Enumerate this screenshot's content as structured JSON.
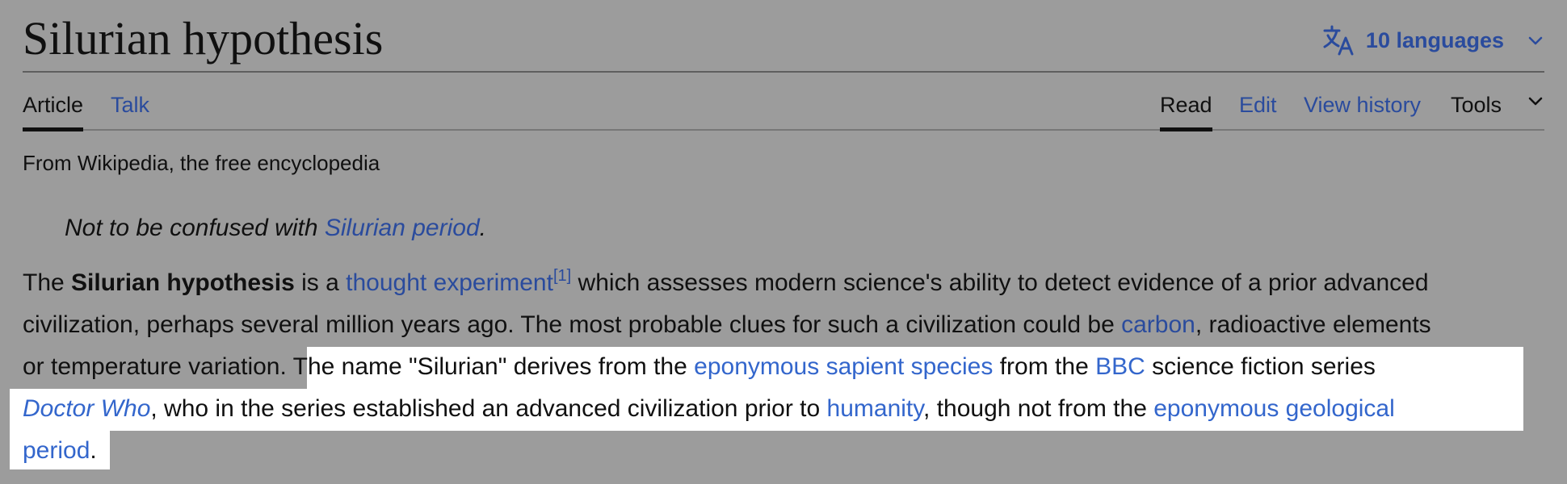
{
  "header": {
    "title": "Silurian hypothesis",
    "languages_label": "10 languages"
  },
  "tabs": {
    "left": [
      {
        "label": "Article",
        "selected": true
      },
      {
        "label": "Talk",
        "selected": false
      }
    ],
    "right": [
      {
        "label": "Read",
        "selected": true
      },
      {
        "label": "Edit",
        "selected": false
      },
      {
        "label": "View history",
        "selected": false
      },
      {
        "label": "Tools",
        "selected": false
      }
    ]
  },
  "tagline": "From Wikipedia, the free encyclopedia",
  "hatnote": {
    "prefix": "Not to be confused with ",
    "link": "Silurian period",
    "suffix": "."
  },
  "paragraph": {
    "line1": {
      "t1": "The ",
      "bold": "Silurian hypothesis",
      "t2": " is a ",
      "link1": "thought experiment",
      "ref": "[1]",
      "t3": " which assesses modern science's ability to detect evidence of a prior advanced"
    },
    "line2": {
      "t1": "civilization, perhaps several million years ago. The most probable clues for such a civilization could be ",
      "link1": "carbon",
      "t2": ", radioactive elements"
    },
    "line3": {
      "t1": "or temperature variation.",
      "t2": " The name \"Silurian\" derives from the ",
      "link1": "eponymous sapient species",
      "t3": " from the ",
      "link2": "BBC",
      "t4": " science fiction series"
    },
    "line4": {
      "link1": "Doctor Who",
      "t1": ", who in the series established an advanced civilization prior to ",
      "link2": "humanity",
      "t2": ", though not from the ",
      "link3": "eponymous geological"
    },
    "line5": {
      "link1": "period",
      "t1": "."
    }
  },
  "colors": {
    "link": "#2a4b9d",
    "highlight_link": "#3366cc",
    "background_dim": "#9c9c9c",
    "highlight_bg": "#ffffff"
  },
  "icons": [
    "translate-icon",
    "chevron-down-icon"
  ]
}
